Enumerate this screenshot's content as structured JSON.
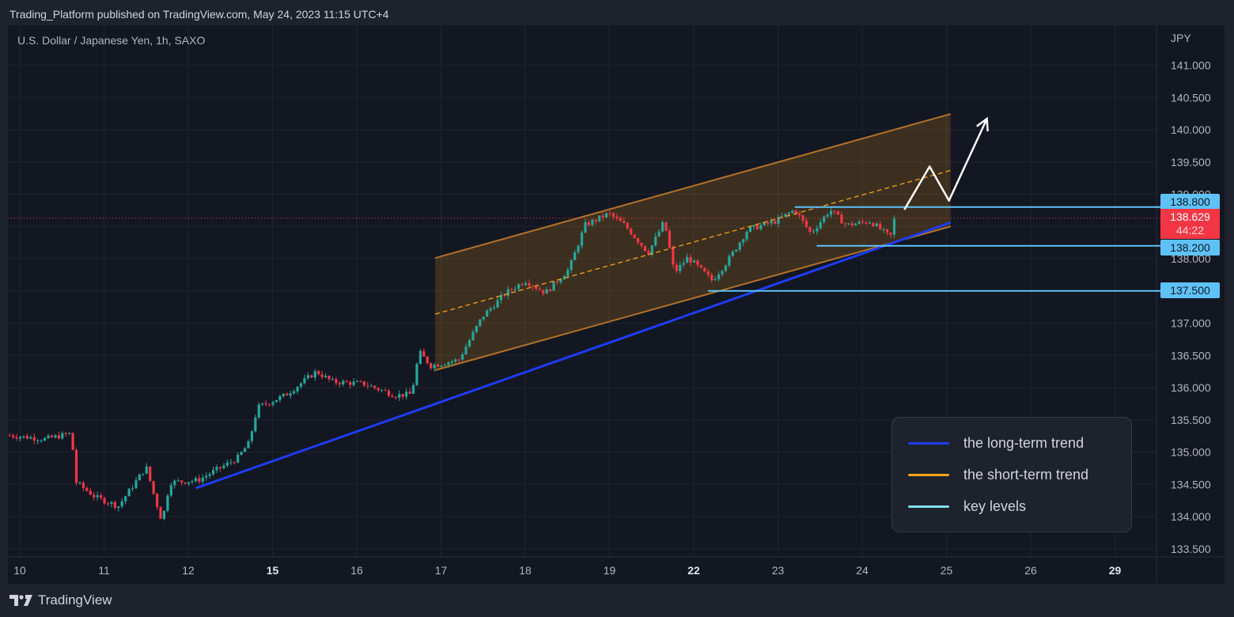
{
  "header": {
    "published": "Trading_Platform published on TradingView.com, May 24, 2023 11:15 UTC+4"
  },
  "symbol": {
    "title": "U.S. Dollar / Japanese Yen, 1h, SAXO"
  },
  "footer": {
    "brand": "TradingView"
  },
  "legend": [
    {
      "label": "the long-term trend",
      "color": "#1e3cf5"
    },
    {
      "label": "the short-term trend",
      "color": "#f7a21b"
    },
    {
      "label": "key levels",
      "color": "#80deea"
    }
  ],
  "current_price": {
    "value": "138.629",
    "countdown": "44:22",
    "color": "#f23645"
  },
  "chart_data": {
    "type": "candlestick",
    "title": "U.S. Dollar / Japanese Yen, 1h, SAXO",
    "currency": "JPY",
    "ylim": [
      133.25,
      141.45
    ],
    "y_ticks": [
      "133.500",
      "134.000",
      "134.500",
      "135.000",
      "135.500",
      "136.000",
      "136.500",
      "137.000",
      "137.500",
      "138.000",
      "138.500",
      "139.000",
      "139.500",
      "140.000",
      "140.500",
      "141.000"
    ],
    "x_ticks": [
      {
        "label": "10",
        "t": 0
      },
      {
        "label": "11",
        "t": 1
      },
      {
        "label": "12",
        "t": 2
      },
      {
        "label": "15",
        "t": 3,
        "bold": true
      },
      {
        "label": "16",
        "t": 4
      },
      {
        "label": "17",
        "t": 5
      },
      {
        "label": "18",
        "t": 6
      },
      {
        "label": "19",
        "t": 7
      },
      {
        "label": "22",
        "t": 8,
        "bold": true
      },
      {
        "label": "23",
        "t": 9
      },
      {
        "label": "24",
        "t": 10
      },
      {
        "label": "25",
        "t": 11
      },
      {
        "label": "26",
        "t": 12
      },
      {
        "label": "29",
        "t": 13,
        "bold": true
      }
    ],
    "xlim": [
      -0.12,
      13.5
    ],
    "price_path": [
      [
        -0.12,
        135.26
      ],
      [
        0.3,
        135.2
      ],
      [
        0.61,
        135.29
      ],
      [
        0.67,
        134.53
      ],
      [
        0.9,
        134.3
      ],
      [
        1.17,
        134.16
      ],
      [
        1.5,
        134.77
      ],
      [
        1.6,
        134.3
      ],
      [
        1.69,
        133.92
      ],
      [
        1.78,
        134.53
      ],
      [
        2.11,
        134.56
      ],
      [
        2.58,
        134.9
      ],
      [
        2.72,
        135.14
      ],
      [
        2.82,
        135.69
      ],
      [
        3.15,
        135.88
      ],
      [
        3.52,
        136.25
      ],
      [
        3.71,
        136.09
      ],
      [
        4.08,
        136.06
      ],
      [
        4.46,
        135.88
      ],
      [
        4.65,
        135.9
      ],
      [
        4.74,
        136.55
      ],
      [
        4.88,
        136.34
      ],
      [
        5.21,
        136.43
      ],
      [
        5.49,
        137.1
      ],
      [
        5.77,
        137.47
      ],
      [
        6.0,
        137.66
      ],
      [
        6.24,
        137.47
      ],
      [
        6.52,
        137.84
      ],
      [
        6.71,
        138.52
      ],
      [
        6.99,
        138.7
      ],
      [
        7.18,
        138.52
      ],
      [
        7.46,
        138.09
      ],
      [
        7.65,
        138.58
      ],
      [
        7.77,
        137.78
      ],
      [
        7.93,
        138.02
      ],
      [
        8.22,
        137.66
      ],
      [
        8.4,
        137.96
      ],
      [
        8.64,
        138.45
      ],
      [
        8.97,
        138.58
      ],
      [
        9.2,
        138.76
      ],
      [
        9.39,
        138.39
      ],
      [
        9.62,
        138.76
      ],
      [
        9.81,
        138.52
      ],
      [
        10.1,
        138.58
      ],
      [
        10.33,
        138.33
      ],
      [
        10.42,
        138.629
      ]
    ],
    "colors": {
      "up": "#26a69a",
      "down": "#f23645"
    },
    "drawings": {
      "channel_upper": [
        [
          4.93,
          138.01
        ],
        [
          11.05,
          140.245
        ]
      ],
      "channel_lower": [
        [
          4.93,
          136.27
        ],
        [
          11.05,
          138.5
        ]
      ],
      "channel_mid": [
        [
          4.93,
          137.14
        ],
        [
          11.05,
          139.37
        ]
      ],
      "long_term_trend": [
        [
          2.09,
          134.44
        ],
        [
          11.05,
          138.56
        ]
      ],
      "key_levels": [
        {
          "label": "138.800",
          "value": 138.8,
          "from_t": 9.2
        },
        {
          "label": "138.200",
          "value": 138.2,
          "from_t": 9.46
        },
        {
          "label": "137.500",
          "value": 137.5,
          "from_t": 8.17
        }
      ],
      "projection": [
        [
          10.5,
          138.76
        ],
        [
          10.8,
          139.43
        ],
        [
          11.03,
          138.9
        ],
        [
          11.48,
          140.17
        ]
      ]
    }
  }
}
